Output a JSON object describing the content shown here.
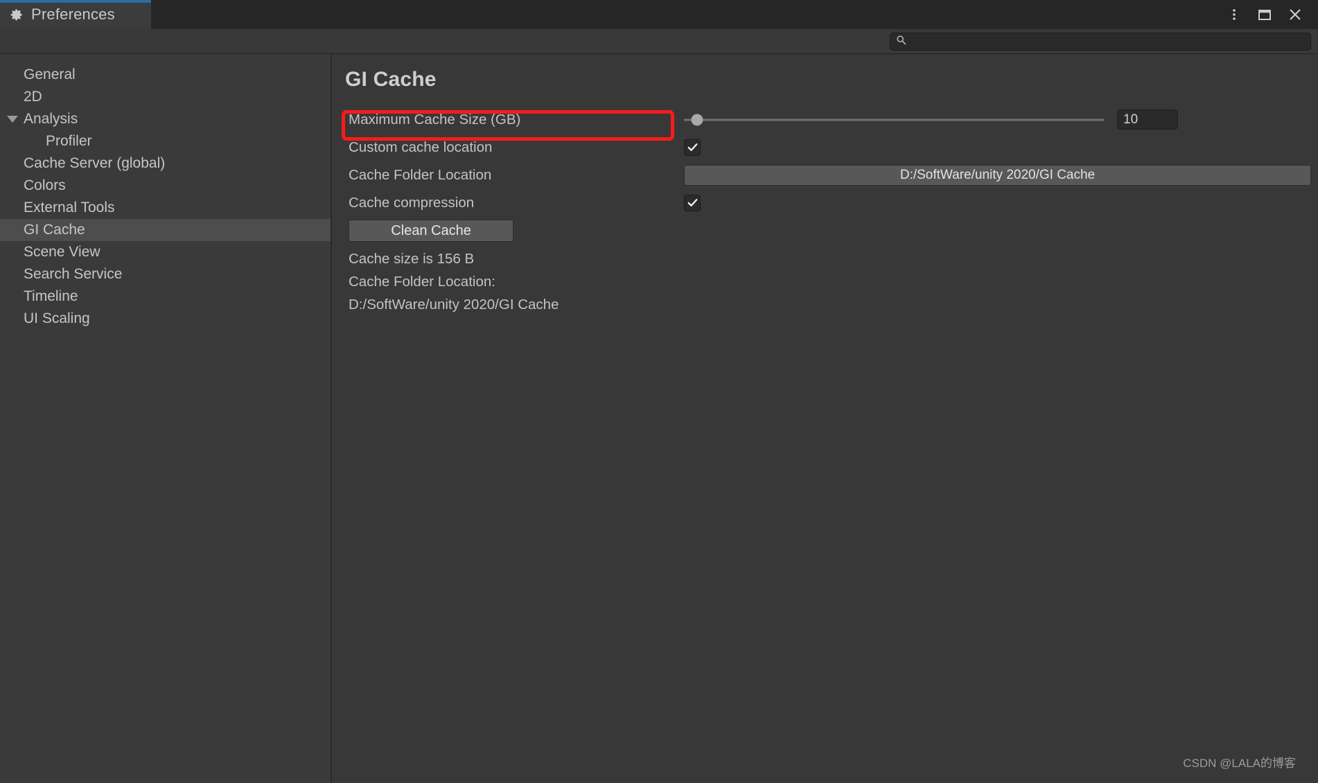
{
  "window": {
    "tab_label": "Preferences",
    "tab_icon": "gear-icon",
    "controls": [
      {
        "name": "more-options-button",
        "icon": "kebab-menu-icon"
      },
      {
        "name": "maximize-button",
        "icon": "maximize-icon"
      },
      {
        "name": "close-button",
        "icon": "close-icon"
      }
    ],
    "accent_color": "#2c6ca3"
  },
  "search": {
    "icon": "search-icon",
    "value": "",
    "placeholder": ""
  },
  "sidebar": {
    "items": [
      {
        "label": "General",
        "indent": 0,
        "selected": false,
        "arrow": false
      },
      {
        "label": "2D",
        "indent": 0,
        "selected": false,
        "arrow": false
      },
      {
        "label": "Analysis",
        "indent": 0,
        "selected": false,
        "arrow": true
      },
      {
        "label": "Profiler",
        "indent": 1,
        "selected": false,
        "arrow": false
      },
      {
        "label": "Cache Server (global)",
        "indent": 0,
        "selected": false,
        "arrow": false
      },
      {
        "label": "Colors",
        "indent": 0,
        "selected": false,
        "arrow": false
      },
      {
        "label": "External Tools",
        "indent": 0,
        "selected": false,
        "arrow": false
      },
      {
        "label": "GI Cache",
        "indent": 0,
        "selected": true,
        "arrow": false
      },
      {
        "label": "Scene View",
        "indent": 0,
        "selected": false,
        "arrow": false
      },
      {
        "label": "Search Service",
        "indent": 0,
        "selected": false,
        "arrow": false
      },
      {
        "label": "Timeline",
        "indent": 0,
        "selected": false,
        "arrow": false
      },
      {
        "label": "UI Scaling",
        "indent": 0,
        "selected": false,
        "arrow": false
      }
    ],
    "selected_color": "#4d4d4d"
  },
  "main": {
    "title": "GI Cache",
    "max_cache_size": {
      "label": "Maximum Cache Size (GB)",
      "value": "10",
      "slider_percent": 3.2,
      "min": 0,
      "max": 200
    },
    "custom_cache_location": {
      "label": "Custom cache location",
      "checked": true
    },
    "cache_folder_location": {
      "label": "Cache Folder Location",
      "value": "D:/SoftWare/unity 2020/GI Cache"
    },
    "cache_compression": {
      "label": "Cache compression",
      "checked": true
    },
    "clean_cache_button": "Clean Cache",
    "cache_size_text": "Cache size is 156 B",
    "cache_folder_label": "Cache Folder Location:",
    "cache_folder_path": "D:/SoftWare/unity 2020/GI Cache"
  },
  "annotation": {
    "highlight_color": "#ff1a1a",
    "target": "custom-cache-location-row"
  },
  "watermark": "CSDN @LALA的博客"
}
